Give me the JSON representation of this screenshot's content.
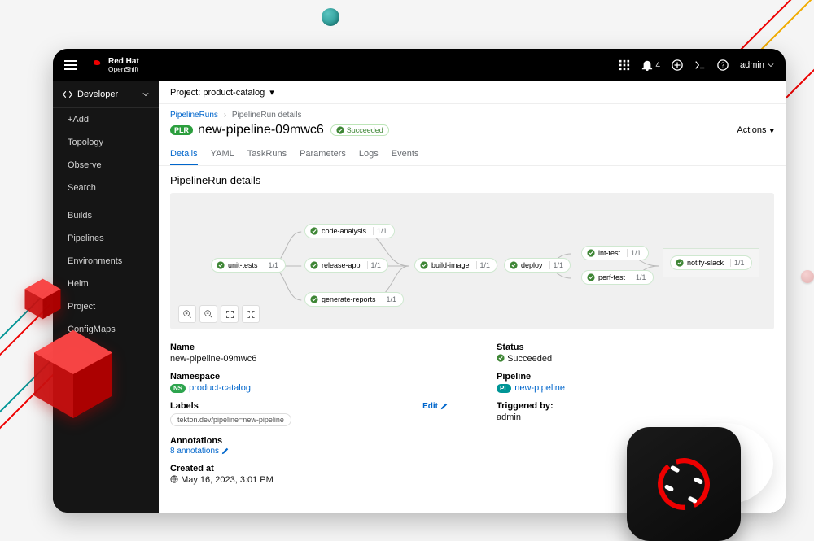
{
  "brand": {
    "line1": "Red Hat",
    "line2": "OpenShift"
  },
  "topbar": {
    "notification_count": "4",
    "user_label": "admin"
  },
  "perspective": {
    "label": "Developer"
  },
  "sidebar": {
    "items": [
      {
        "label": "+Add"
      },
      {
        "label": "Topology"
      },
      {
        "label": "Observe"
      },
      {
        "label": "Search"
      },
      {
        "label": "Builds"
      },
      {
        "label": "Pipelines"
      },
      {
        "label": "Environments"
      },
      {
        "label": "Helm"
      },
      {
        "label": "Project"
      },
      {
        "label": "ConfigMaps"
      }
    ]
  },
  "project_bar": {
    "prefix": "Project:",
    "name": "product-catalog"
  },
  "breadcrumb": {
    "root": "PipelineRuns",
    "leaf": "PipelineRun details"
  },
  "header": {
    "badge": "PLR",
    "title": "new-pipeline-09mwc6",
    "status": "Succeeded",
    "actions_label": "Actions"
  },
  "tabs": [
    {
      "label": "Details",
      "active": true
    },
    {
      "label": "YAML"
    },
    {
      "label": "TaskRuns"
    },
    {
      "label": "Parameters"
    },
    {
      "label": "Logs"
    },
    {
      "label": "Events"
    }
  ],
  "section_heading": "PipelineRun details",
  "graph": {
    "ratio": "1/1",
    "nodes": {
      "unit_tests": "unit-tests",
      "code_analysis": "code-analysis",
      "release_app": "release-app",
      "generate_reports": "generate-reports",
      "build_image": "build-image",
      "deploy": "deploy",
      "int_test": "int-test",
      "perf_test": "perf-test",
      "notify_slack": "notify-slack"
    }
  },
  "details": {
    "name_label": "Name",
    "name_value": "new-pipeline-09mwc6",
    "namespace_label": "Namespace",
    "namespace_badge": "NS",
    "namespace_value": "product-catalog",
    "labels_label": "Labels",
    "edit_label": "Edit",
    "label_chip": "tekton.dev/pipeline=new-pipeline",
    "annotations_label": "Annotations",
    "annotations_link": "8 annotations",
    "created_label": "Created at",
    "created_value": "May 16, 2023, 3:01 PM",
    "status_label": "Status",
    "status_value": "Succeeded",
    "pipeline_label": "Pipeline",
    "pipeline_badge": "PL",
    "pipeline_value": "new-pipeline",
    "triggered_label": "Triggered by:",
    "triggered_value": "admin"
  }
}
